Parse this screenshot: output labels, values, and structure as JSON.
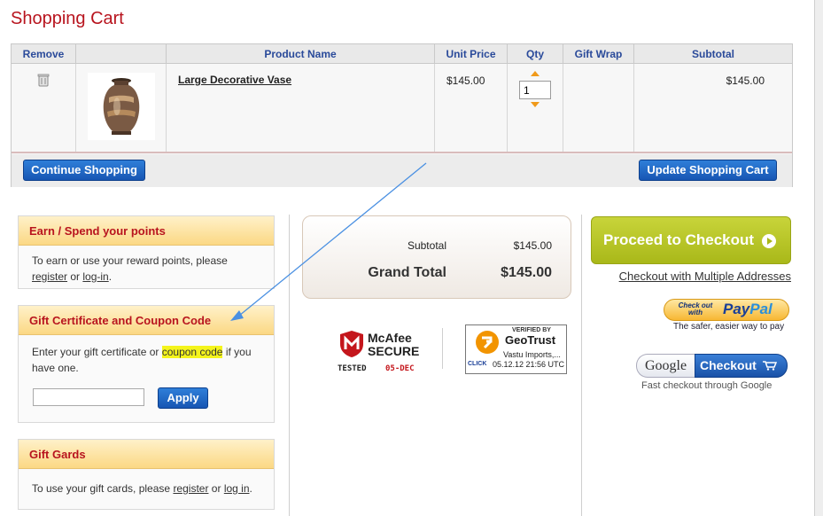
{
  "page": {
    "title": "Shopping Cart"
  },
  "table": {
    "headers": {
      "remove": "Remove",
      "product_name": "Product Name",
      "unit_price": "Unit Price",
      "qty": "Qty",
      "gift_wrap": "Gift Wrap",
      "subtotal": "Subtotal"
    },
    "rows": [
      {
        "product_name": "Large Decorative Vase",
        "unit_price": "$145.00",
        "qty": "1",
        "gift_wrap": "",
        "subtotal": "$145.00"
      }
    ]
  },
  "buttons": {
    "continue_shopping": "Continue Shopping",
    "update_cart": "Update Shopping Cart",
    "apply": "Apply",
    "proceed": "Proceed to Checkout",
    "multiple_addresses": "Checkout with Multiple Addresses"
  },
  "points_box": {
    "title": "Earn / Spend your points",
    "text_before": "To earn or use your reward points, please",
    "register": "register",
    "or": "or",
    "login": "log-in",
    "end": "."
  },
  "coupon_box": {
    "title": "Gift Certificate and Coupon Code",
    "text_before": "Enter your gift certificate or",
    "highlight": "coupon code",
    "text_after": "if you have one.",
    "input_value": ""
  },
  "giftcard_box": {
    "title": "Gift Gards",
    "text_before": "To use your gift cards, please",
    "register": "register",
    "or": "or",
    "login": "log in",
    "end": "."
  },
  "totals": {
    "subtotal_label": "Subtotal",
    "subtotal_value": "$145.00",
    "grand_label": "Grand Total",
    "grand_value": "$145.00"
  },
  "badges": {
    "mcafee_brand": "McAfee",
    "mcafee_secure": "SECURE",
    "mcafee_tested": "TESTED",
    "mcafee_date": "05-DEC",
    "geotrust_verified": "VERIFIED BY",
    "geotrust_brand": "GeoTrust",
    "geotrust_company": "Vastu Imports,...",
    "geotrust_click": "CLICK",
    "geotrust_date": "05.12.12 21:56 UTC"
  },
  "paypal": {
    "small": "Check out with",
    "brand_pay": "Pay",
    "brand_pal": "Pal",
    "tagline": "The safer, easier way to pay"
  },
  "google": {
    "logo": "Google",
    "button": "Checkout",
    "tagline": "Fast checkout through Google"
  },
  "colors": {
    "title_red": "#b8141e",
    "header_blue": "#2a4a9a",
    "button_blue": "#1756b3",
    "proceed_green": "#a9b819",
    "box_header_gold": "#fbd884",
    "annotation_arrow": "#4a90e2",
    "highlight_yellow": "#f4f41c"
  },
  "icons": {
    "remove": "trash-icon",
    "qty_up": "arrow-up-icon",
    "qty_down": "arrow-down-icon",
    "proceed": "circle-arrow-right-icon",
    "google_cart": "cart-icon",
    "annotation": "annotation-arrow"
  }
}
